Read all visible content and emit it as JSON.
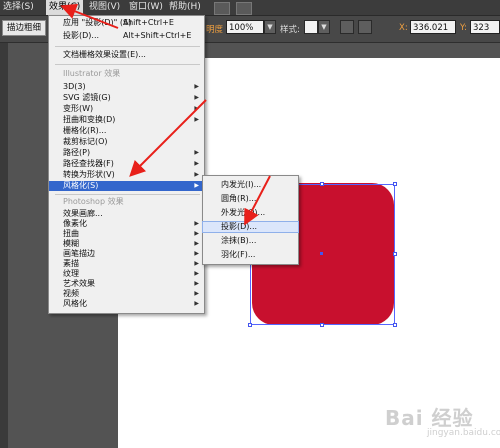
{
  "menubar": {
    "items": [
      {
        "label": "选择(S)"
      },
      {
        "label": "效果(C)"
      },
      {
        "label": "视图(V)"
      },
      {
        "label": "窗口(W)"
      },
      {
        "label": "帮助(H)"
      }
    ]
  },
  "ctrlbar": {
    "tool_pill": "描边粗细",
    "opacity_label": "明度",
    "opacity_value": "100%",
    "style_label": "样式:",
    "x_label": "X:",
    "x_value": "336.021",
    "y_label": "Y:",
    "y_value": "323"
  },
  "effect_menu": {
    "apply_label": "应用 \"投影(D)\" (A)",
    "apply_shortcut": "Shift+Ctrl+E",
    "last_label": "投影(D)...",
    "last_shortcut": "Alt+Shift+Ctrl+E",
    "raster_settings": "文档栅格效果设置(E)...",
    "illustrator_header": "Illustrator 效果",
    "illustrator_items": [
      {
        "label": "3D(3)"
      },
      {
        "label": "SVG 滤镜(G)"
      },
      {
        "label": "变形(W)"
      },
      {
        "label": "扭曲和变换(D)"
      },
      {
        "label": "栅格化(R)..."
      },
      {
        "label": "裁剪标记(O)"
      },
      {
        "label": "路径(P)"
      },
      {
        "label": "路径查找器(F)"
      },
      {
        "label": "转换为形状(V)"
      },
      {
        "label": "风格化(S)"
      }
    ],
    "photoshop_header": "Photoshop 效果",
    "photoshop_items": [
      {
        "label": "效果画廊..."
      },
      {
        "label": "像素化"
      },
      {
        "label": "扭曲"
      },
      {
        "label": "模糊"
      },
      {
        "label": "画笔描边"
      },
      {
        "label": "素描"
      },
      {
        "label": "纹理"
      },
      {
        "label": "艺术效果"
      },
      {
        "label": "视频"
      },
      {
        "label": "风格化"
      }
    ]
  },
  "stylize_submenu": {
    "items": [
      {
        "label": "内发光(I)..."
      },
      {
        "label": "圆角(R)..."
      },
      {
        "label": "外发光(O)..."
      },
      {
        "label": "投影(D)..."
      },
      {
        "label": "涂抹(B)..."
      },
      {
        "label": "羽化(F)..."
      }
    ]
  },
  "watermark": {
    "main": "Bai 经验",
    "sub": "jingyan.baidu.com"
  },
  "colors": {
    "shape_fill": "#c8102e",
    "highlight": "#3366cc",
    "annotation": "#e8201a",
    "selection": "#5566ff"
  }
}
